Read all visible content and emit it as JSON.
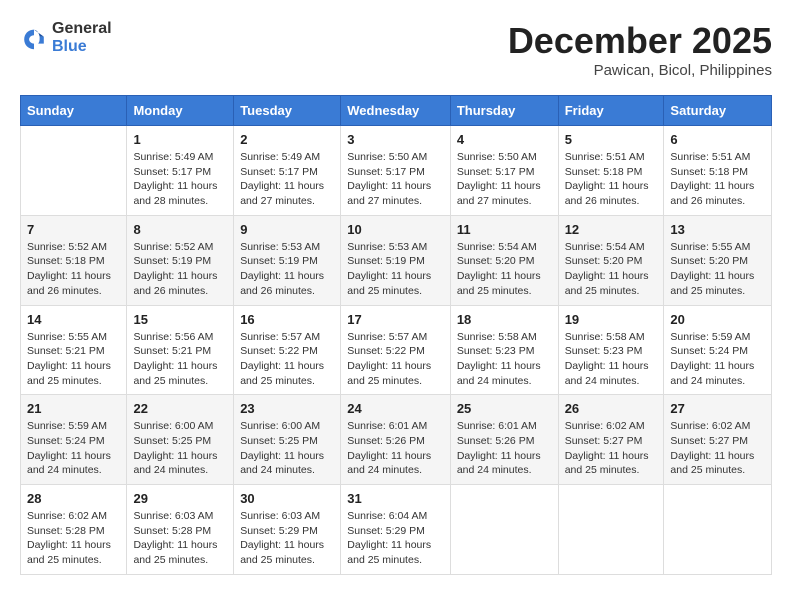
{
  "header": {
    "logo_general": "General",
    "logo_blue": "Blue",
    "month": "December 2025",
    "location": "Pawican, Bicol, Philippines"
  },
  "weekdays": [
    "Sunday",
    "Monday",
    "Tuesday",
    "Wednesday",
    "Thursday",
    "Friday",
    "Saturday"
  ],
  "weeks": [
    [
      {
        "day": "",
        "info": ""
      },
      {
        "day": "1",
        "info": "Sunrise: 5:49 AM\nSunset: 5:17 PM\nDaylight: 11 hours and 28 minutes."
      },
      {
        "day": "2",
        "info": "Sunrise: 5:49 AM\nSunset: 5:17 PM\nDaylight: 11 hours and 27 minutes."
      },
      {
        "day": "3",
        "info": "Sunrise: 5:50 AM\nSunset: 5:17 PM\nDaylight: 11 hours and 27 minutes."
      },
      {
        "day": "4",
        "info": "Sunrise: 5:50 AM\nSunset: 5:17 PM\nDaylight: 11 hours and 27 minutes."
      },
      {
        "day": "5",
        "info": "Sunrise: 5:51 AM\nSunset: 5:18 PM\nDaylight: 11 hours and 26 minutes."
      },
      {
        "day": "6",
        "info": "Sunrise: 5:51 AM\nSunset: 5:18 PM\nDaylight: 11 hours and 26 minutes."
      }
    ],
    [
      {
        "day": "7",
        "info": "Sunrise: 5:52 AM\nSunset: 5:18 PM\nDaylight: 11 hours and 26 minutes."
      },
      {
        "day": "8",
        "info": "Sunrise: 5:52 AM\nSunset: 5:19 PM\nDaylight: 11 hours and 26 minutes."
      },
      {
        "day": "9",
        "info": "Sunrise: 5:53 AM\nSunset: 5:19 PM\nDaylight: 11 hours and 26 minutes."
      },
      {
        "day": "10",
        "info": "Sunrise: 5:53 AM\nSunset: 5:19 PM\nDaylight: 11 hours and 25 minutes."
      },
      {
        "day": "11",
        "info": "Sunrise: 5:54 AM\nSunset: 5:20 PM\nDaylight: 11 hours and 25 minutes."
      },
      {
        "day": "12",
        "info": "Sunrise: 5:54 AM\nSunset: 5:20 PM\nDaylight: 11 hours and 25 minutes."
      },
      {
        "day": "13",
        "info": "Sunrise: 5:55 AM\nSunset: 5:20 PM\nDaylight: 11 hours and 25 minutes."
      }
    ],
    [
      {
        "day": "14",
        "info": "Sunrise: 5:55 AM\nSunset: 5:21 PM\nDaylight: 11 hours and 25 minutes."
      },
      {
        "day": "15",
        "info": "Sunrise: 5:56 AM\nSunset: 5:21 PM\nDaylight: 11 hours and 25 minutes."
      },
      {
        "day": "16",
        "info": "Sunrise: 5:57 AM\nSunset: 5:22 PM\nDaylight: 11 hours and 25 minutes."
      },
      {
        "day": "17",
        "info": "Sunrise: 5:57 AM\nSunset: 5:22 PM\nDaylight: 11 hours and 25 minutes."
      },
      {
        "day": "18",
        "info": "Sunrise: 5:58 AM\nSunset: 5:23 PM\nDaylight: 11 hours and 24 minutes."
      },
      {
        "day": "19",
        "info": "Sunrise: 5:58 AM\nSunset: 5:23 PM\nDaylight: 11 hours and 24 minutes."
      },
      {
        "day": "20",
        "info": "Sunrise: 5:59 AM\nSunset: 5:24 PM\nDaylight: 11 hours and 24 minutes."
      }
    ],
    [
      {
        "day": "21",
        "info": "Sunrise: 5:59 AM\nSunset: 5:24 PM\nDaylight: 11 hours and 24 minutes."
      },
      {
        "day": "22",
        "info": "Sunrise: 6:00 AM\nSunset: 5:25 PM\nDaylight: 11 hours and 24 minutes."
      },
      {
        "day": "23",
        "info": "Sunrise: 6:00 AM\nSunset: 5:25 PM\nDaylight: 11 hours and 24 minutes."
      },
      {
        "day": "24",
        "info": "Sunrise: 6:01 AM\nSunset: 5:26 PM\nDaylight: 11 hours and 24 minutes."
      },
      {
        "day": "25",
        "info": "Sunrise: 6:01 AM\nSunset: 5:26 PM\nDaylight: 11 hours and 24 minutes."
      },
      {
        "day": "26",
        "info": "Sunrise: 6:02 AM\nSunset: 5:27 PM\nDaylight: 11 hours and 25 minutes."
      },
      {
        "day": "27",
        "info": "Sunrise: 6:02 AM\nSunset: 5:27 PM\nDaylight: 11 hours and 25 minutes."
      }
    ],
    [
      {
        "day": "28",
        "info": "Sunrise: 6:02 AM\nSunset: 5:28 PM\nDaylight: 11 hours and 25 minutes."
      },
      {
        "day": "29",
        "info": "Sunrise: 6:03 AM\nSunset: 5:28 PM\nDaylight: 11 hours and 25 minutes."
      },
      {
        "day": "30",
        "info": "Sunrise: 6:03 AM\nSunset: 5:29 PM\nDaylight: 11 hours and 25 minutes."
      },
      {
        "day": "31",
        "info": "Sunrise: 6:04 AM\nSunset: 5:29 PM\nDaylight: 11 hours and 25 minutes."
      },
      {
        "day": "",
        "info": ""
      },
      {
        "day": "",
        "info": ""
      },
      {
        "day": "",
        "info": ""
      }
    ]
  ]
}
